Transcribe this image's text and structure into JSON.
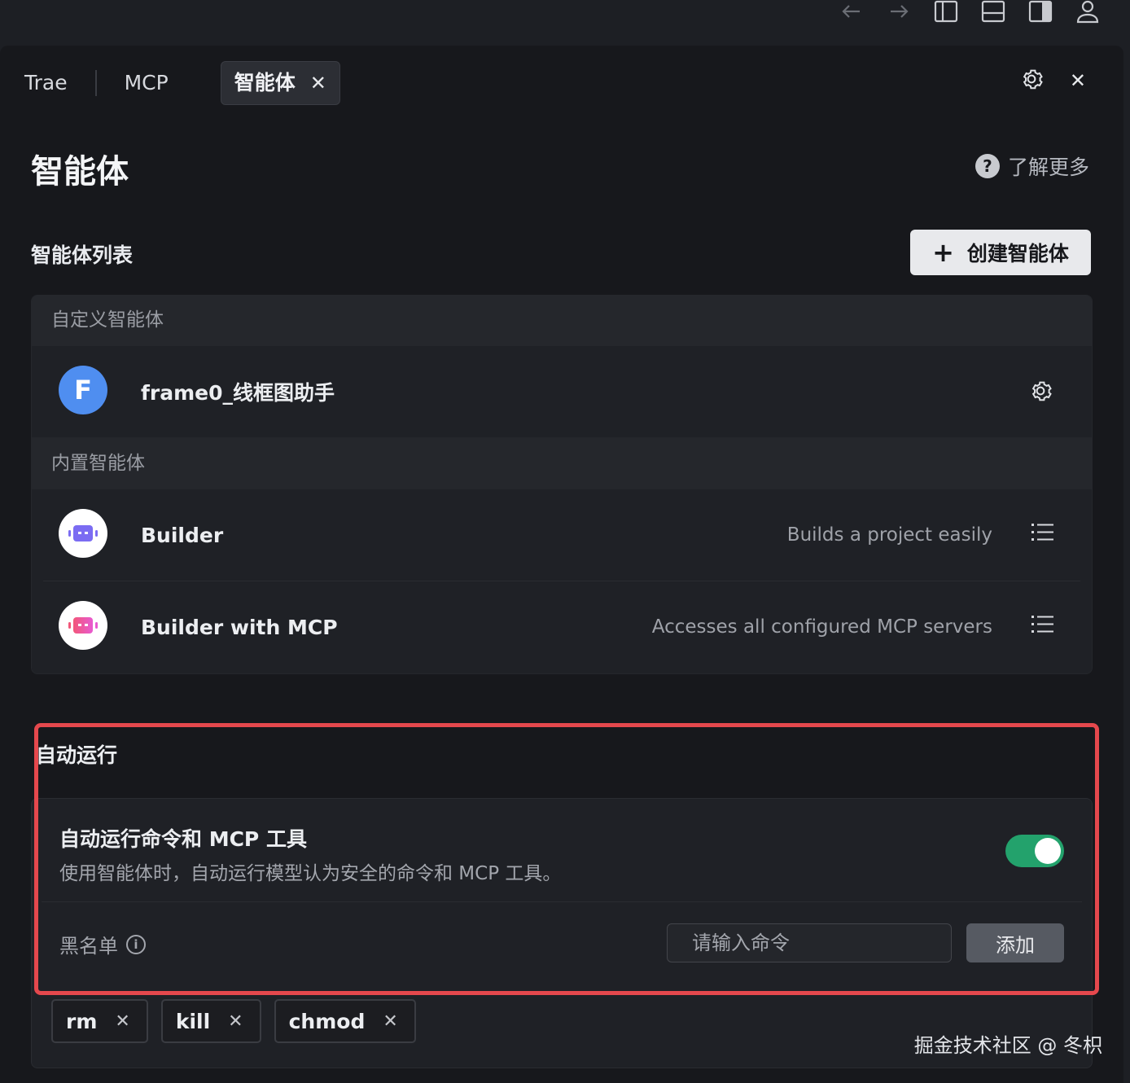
{
  "tabs": [
    {
      "label": "Trae"
    },
    {
      "label": "MCP"
    },
    {
      "label": "智能体",
      "active": true
    }
  ],
  "page": {
    "title": "智能体",
    "learn_more": "了解更多"
  },
  "agents_section": {
    "title": "智能体列表",
    "create_label": "创建智能体",
    "custom_group": "自定义智能体",
    "builtin_group": "内置智能体",
    "custom": [
      {
        "avatar_letter": "F",
        "name": "frame0_线框图助手",
        "avatar_color": "#4f8ef0"
      }
    ],
    "builtin": [
      {
        "name": "Builder",
        "description": "Builds a project easily",
        "icon": "robot-purple-icon"
      },
      {
        "name": "Builder with MCP",
        "description": "Accesses all configured MCP servers",
        "icon": "robot-pink-icon"
      }
    ]
  },
  "auto_run": {
    "title": "自动运行",
    "option_title": "自动运行命令和 MCP 工具",
    "option_desc": "使用智能体时，自动运行模型认为安全的命令和 MCP 工具。",
    "enabled": true,
    "toggle_color": "#23a26c",
    "blacklist_label": "黑名单",
    "input_placeholder": "请输入命令",
    "add_label": "添加",
    "blacklist": [
      "rm",
      "kill",
      "chmod"
    ]
  },
  "watermark": "掘金技术社区 @ 冬枳",
  "colors": {
    "highlight": "#e5484d",
    "background": "#17181c"
  }
}
